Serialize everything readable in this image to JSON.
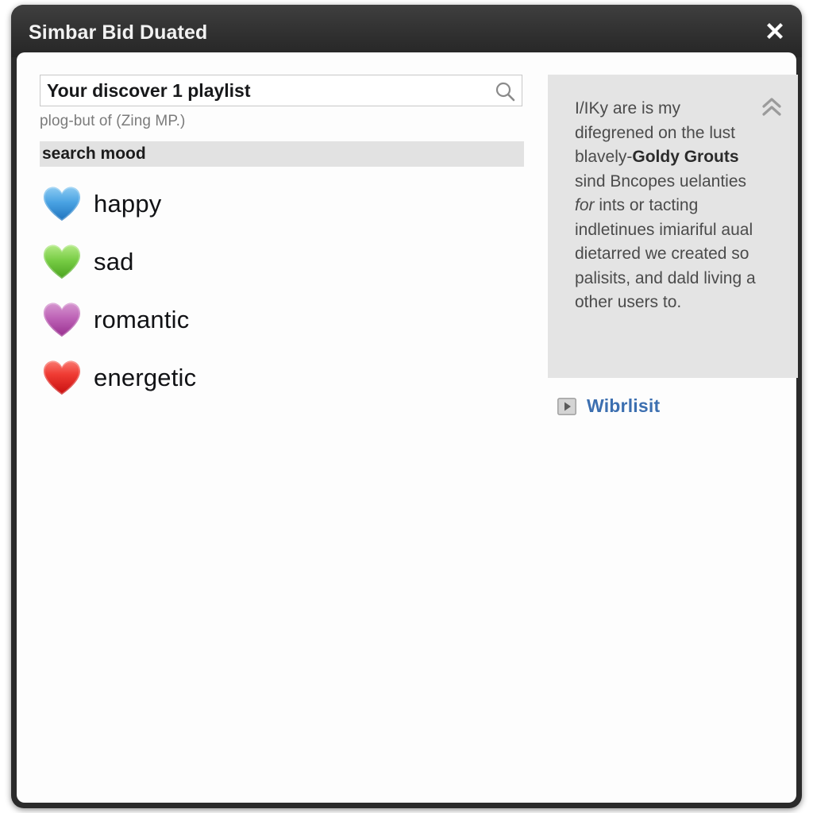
{
  "window": {
    "title": "Simbar Bid Duated",
    "close_icon": "close-x-icon",
    "frame_color": "#2b2b2b",
    "titlebar_color": "#343434",
    "content_bg": "#fdfdfd"
  },
  "search": {
    "value": "Your discover 1 playlist",
    "placeholder": "Your discover 1 playlist",
    "icon": "search-magnifier-icon",
    "subtitle": "plog-but of (Zing MP.)"
  },
  "section": {
    "header": "search mood",
    "header_bg": "#e2e2e2"
  },
  "moods": [
    {
      "label": "happy",
      "icon": "heart-icon",
      "color": "#3d9be0",
      "color_light": "#7fc4ef",
      "color_dark": "#1f73bd"
    },
    {
      "label": "sad",
      "icon": "heart-icon",
      "color": "#6ec53a",
      "color_light": "#a7e377",
      "color_dark": "#4aa21f"
    },
    {
      "label": "romantic",
      "icon": "heart-icon",
      "color": "#b755b0",
      "color_light": "#d18ccb",
      "color_dark": "#99308f"
    },
    {
      "label": "energetic",
      "icon": "heart-icon",
      "color": "#ea2b28",
      "color_light": "#f96f6a",
      "color_dark": "#c70f10"
    }
  ],
  "info_panel": {
    "bg": "#e4e4e4",
    "collapse_icon": "chevron-double-up-icon",
    "lines": [
      {
        "text": "I/IKy are is my"
      },
      {
        "text": "difegrened on the"
      },
      {
        "text": "lust blavely-"
      },
      {
        "text": "Goldy Grouts",
        "bold": true
      },
      {
        "text": " sind"
      },
      {
        "text": "Bncopes uelanties "
      },
      {
        "text": "for",
        "italic": true
      },
      {
        "text": " ints or tacting indletinues imiariful aual dietarred we created so palisits, and dald living a other users to."
      }
    ],
    "plain_text": "I/IKy are is my difegrened on the lust blavely-Goldy Grouts sind Bncopes uelanties for ints or tacting indletinues imiariful aual dietarred we created so palisits, and dald living a other users to."
  },
  "link": {
    "label": "Wibrlisit",
    "icon": "play-button-icon",
    "color": "#3c6fb0"
  }
}
